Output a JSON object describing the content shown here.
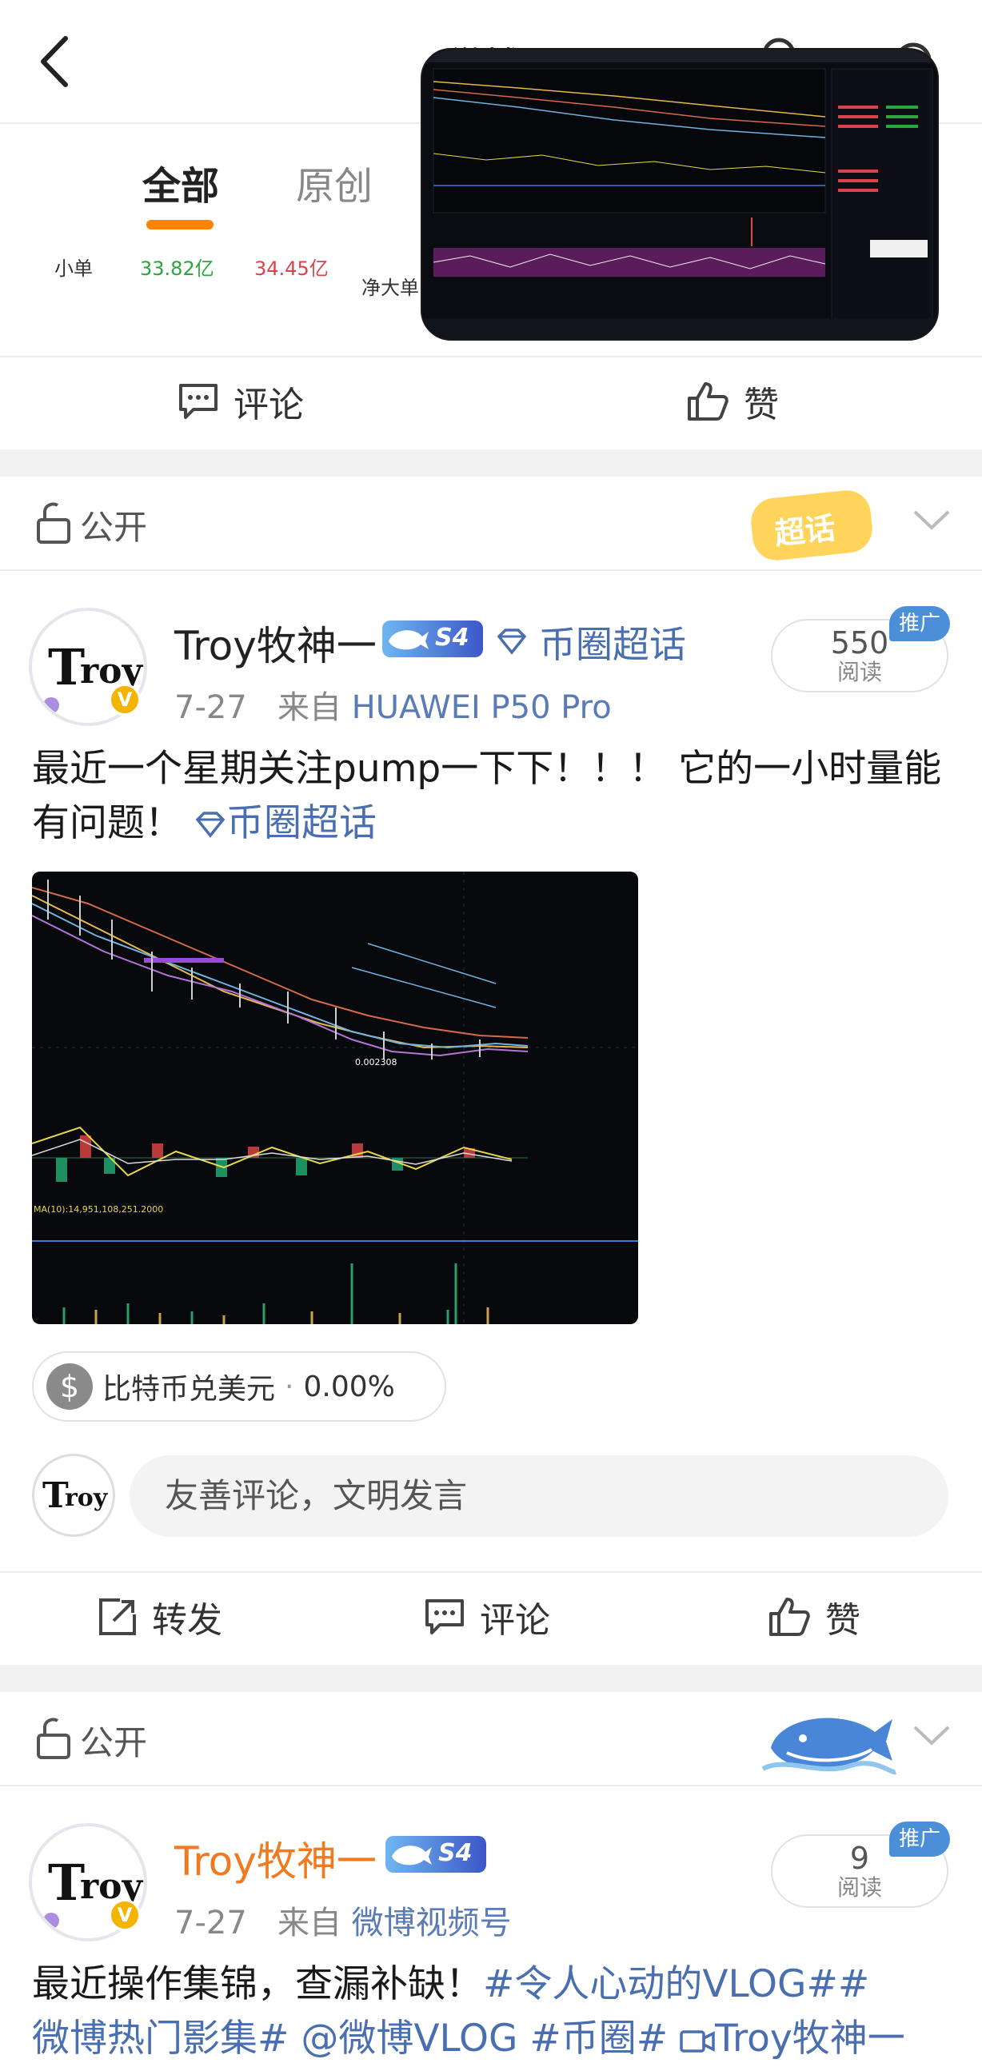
{
  "header": {
    "title": "微博",
    "tabs": [
      {
        "label": "全部",
        "active": true
      },
      {
        "label": "原创",
        "active": false
      }
    ]
  },
  "order_flow": {
    "label": "小单",
    "buy": "33.82亿",
    "sell": "34.45亿",
    "net_label": "净大单"
  },
  "actions_top": {
    "comment": "评论",
    "like": "赞"
  },
  "posts": [
    {
      "privacy": "公开",
      "sticker": "超话",
      "author": "Troy牧神一",
      "level_badge": "S4",
      "supertopic": "币圈超话",
      "reads": "550",
      "reads_label": "阅读",
      "promo": "推广",
      "date": "7-27",
      "source_prefix": "来自",
      "source": "HUAWEI P50 Pro",
      "text": "最近一个星期关注pump一下下！！！ 它的一小时量能有问题！",
      "text_link": "币圈超话",
      "chart_price_label": "0.002308",
      "chart_ma_label": "MA(10):14,951,108,251.2000",
      "stock_name": "比特币兑美元",
      "stock_change": "0.00%",
      "comment_placeholder": "友善评论，文明发言",
      "actions": {
        "repost": "转发",
        "comment": "评论",
        "like": "赞"
      }
    },
    {
      "privacy": "公开",
      "author": "Troy牧神一",
      "level_badge": "S4",
      "reads": "9",
      "reads_label": "阅读",
      "promo": "推广",
      "date": "7-27",
      "source_prefix": "来自",
      "source": "微博视频号",
      "text_plain": "最近操作集锦，查漏补缺！",
      "text_links_line1": "#令人心动的VLOG##",
      "text_links_line2": "微博热门影集# @微博VLOG #币圈# ",
      "text_video_link": "Troy牧神一"
    }
  ],
  "colors": {
    "accent": "#ff8200",
    "link": "#4a6fb0",
    "buy": "#2aa63b",
    "sell": "#d9444a",
    "promo": "#4b8fd9"
  }
}
